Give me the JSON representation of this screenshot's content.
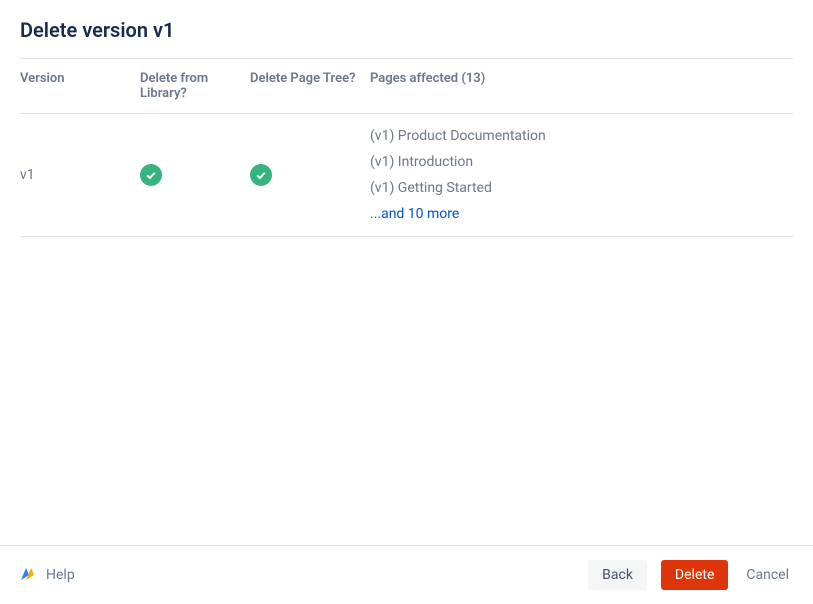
{
  "header": {
    "title": "Delete version v1"
  },
  "table": {
    "columns": {
      "version": "Version",
      "deleteLibrary": "Delete from Library?",
      "deleteTree": "Delete Page Tree?",
      "pagesAffected": "Pages affected (13)"
    },
    "row": {
      "version": "v1",
      "pages": [
        "(v1) Product Documentation",
        "(v1) Introduction",
        "(v1) Getting Started"
      ],
      "moreText": "...and 10 more"
    }
  },
  "footer": {
    "help": "Help",
    "back": "Back",
    "delete": "Delete",
    "cancel": "Cancel"
  }
}
